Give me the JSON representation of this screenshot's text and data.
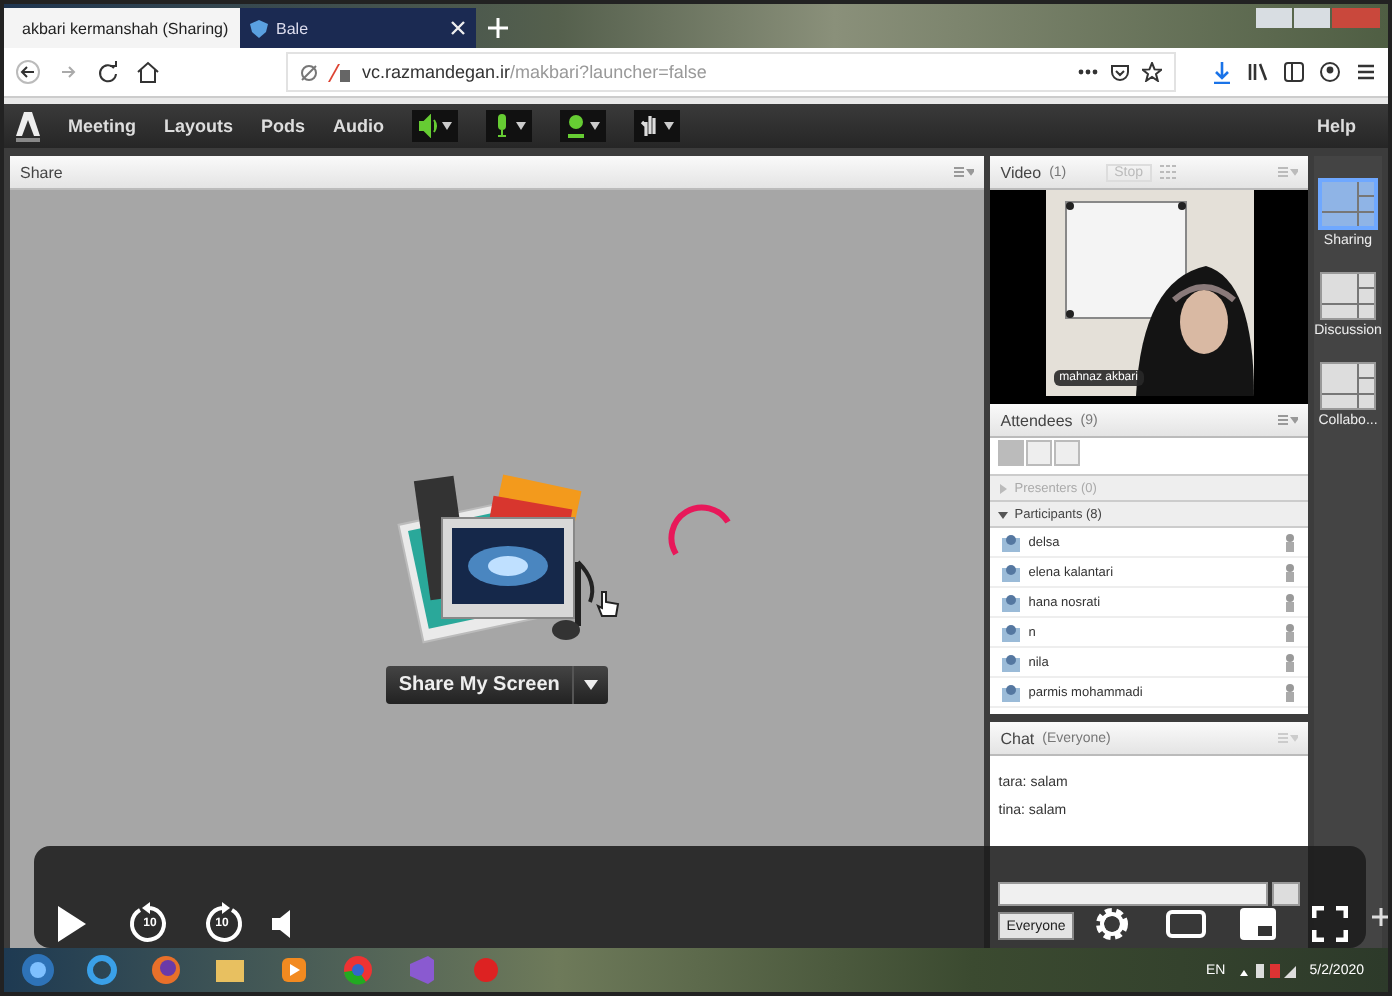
{
  "browser": {
    "tabs": [
      {
        "title": "akbari kermanshah (Sharing)",
        "selected": true
      },
      {
        "title": "Bale",
        "selected": false
      }
    ],
    "url_host": "vc.razmandegan.ir",
    "url_path": "/makbari?launcher=false"
  },
  "meeting_bar": {
    "menus": [
      "Meeting",
      "Layouts",
      "Pods",
      "Audio"
    ],
    "help": "Help"
  },
  "share_pod": {
    "title": "Share",
    "button": "Share My Screen"
  },
  "video_pod": {
    "title": "Video",
    "count": "(1)",
    "stop": "Stop",
    "name_label": "mahnaz akbari"
  },
  "attendees_pod": {
    "title": "Attendees",
    "count": "(9)",
    "groups": [
      {
        "label": "Presenters (0)",
        "expanded": false
      },
      {
        "label": "Participants (8)",
        "expanded": true,
        "children": [
          {
            "name": "delsa"
          },
          {
            "name": "elena kalantari"
          },
          {
            "name": "hana nosrati"
          },
          {
            "name": "n"
          },
          {
            "name": "nila"
          },
          {
            "name": "parmis mohammadi"
          }
        ]
      }
    ]
  },
  "chat_pod": {
    "title": "Chat",
    "audience": "(Everyone)",
    "messages": [
      "tara: salam",
      "tina: salam"
    ],
    "send_to": "Everyone"
  },
  "layouts": [
    {
      "label": "Sharing",
      "selected": true
    },
    {
      "label": "Discussion",
      "selected": false
    },
    {
      "label": "Collabo...",
      "selected": false
    }
  ],
  "player": {
    "rewind_label": "10",
    "forward_label": "10"
  },
  "taskbar": {
    "language": "EN",
    "date": "5/2/2020"
  }
}
